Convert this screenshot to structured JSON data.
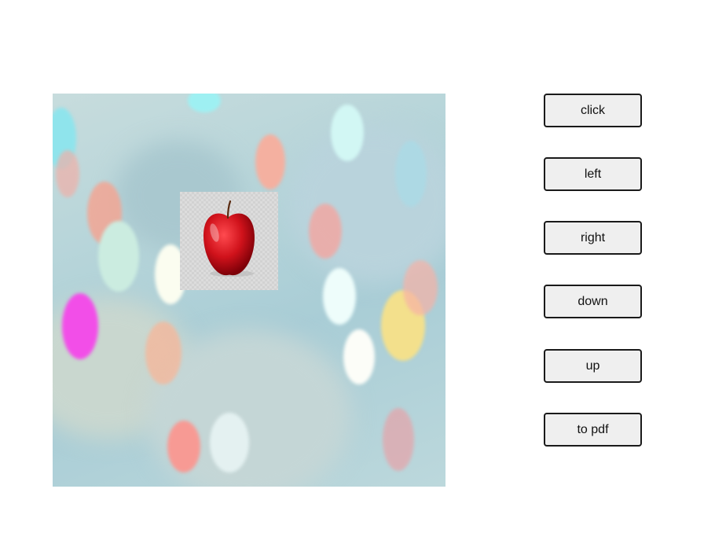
{
  "scene": {
    "background": "blurred-bokeh-lights",
    "sprite_icon": "apple-icon",
    "colors": {
      "button_fill": "#efefef",
      "button_border": "#1a1a1a",
      "apple_red": "#d0121b"
    }
  },
  "controls": {
    "click_label": "click",
    "left_label": "left",
    "right_label": "right",
    "down_label": "down",
    "up_label": "up",
    "pdf_label": "to pdf"
  }
}
